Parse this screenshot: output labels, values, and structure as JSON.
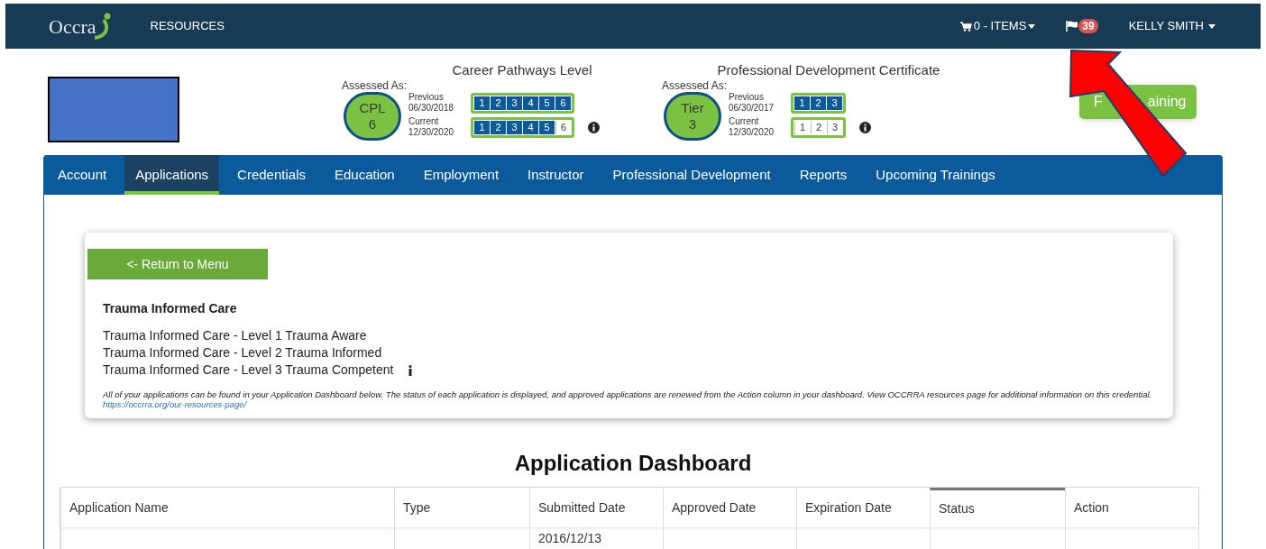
{
  "header": {
    "logo": "Occra",
    "nav": [
      {
        "label": "RESOURCES"
      }
    ],
    "cart": {
      "label": "0 - ITEMS"
    },
    "flag_count": "39",
    "user": "KELLY SMITH"
  },
  "career_pathways": {
    "title": "Career Pathways Level",
    "assessed_label": "Assessed As:",
    "badge": [
      "CPL",
      "6"
    ],
    "previous": {
      "label": "Previous",
      "date": "06/30/2018",
      "steps": [
        {
          "label": "1",
          "achieved": true
        },
        {
          "label": "2",
          "achieved": true
        },
        {
          "label": "3",
          "achieved": true
        },
        {
          "label": "4",
          "achieved": true
        },
        {
          "label": "5",
          "achieved": true
        },
        {
          "label": "6",
          "achieved": true
        }
      ]
    },
    "current": {
      "label": "Current",
      "date": "12/30/2020",
      "steps": [
        {
          "label": "1",
          "achieved": true
        },
        {
          "label": "2",
          "achieved": true
        },
        {
          "label": "3",
          "achieved": true
        },
        {
          "label": "4",
          "achieved": true
        },
        {
          "label": "5",
          "achieved": true
        },
        {
          "label": "6",
          "achieved": false
        }
      ]
    }
  },
  "pdc": {
    "title": "Professional Development Certificate",
    "assessed_label": "Assessed As:",
    "badge": [
      "Tier",
      "3"
    ],
    "previous": {
      "label": "Previous",
      "date": "06/30/2017",
      "steps": [
        {
          "label": "1",
          "achieved": true
        },
        {
          "label": "2",
          "achieved": true
        },
        {
          "label": "3",
          "achieved": true
        }
      ]
    },
    "current": {
      "label": "Current",
      "date": "12/30/2020",
      "steps": [
        {
          "label": "1",
          "achieved": false
        },
        {
          "label": "2",
          "achieved": false
        },
        {
          "label": "3",
          "achieved": false
        }
      ]
    }
  },
  "find_training_button": {
    "visible_parts": [
      "F",
      "aining"
    ]
  },
  "tabs": [
    {
      "label": "Account",
      "selected": false
    },
    {
      "label": "Applications",
      "selected": true
    },
    {
      "label": "Credentials",
      "selected": false
    },
    {
      "label": "Education",
      "selected": false
    },
    {
      "label": "Employment",
      "selected": false
    },
    {
      "label": "Instructor",
      "selected": false
    },
    {
      "label": "Professional Development",
      "selected": false
    },
    {
      "label": "Reports",
      "selected": false
    },
    {
      "label": "Upcoming Trainings",
      "selected": false
    }
  ],
  "card": {
    "return_button": "<- Return to Menu",
    "title": "Trauma Informed Care",
    "levels": [
      "Trauma Informed Care - Level 1 Trauma Aware",
      "Trauma Informed Care - Level 2 Trauma Informed",
      "Trauma Informed Care - Level 3 Trauma Competent"
    ],
    "note": "All of your applications can be found in your Application Dashboard below. The status of each application is displayed, and approved applications are renewed from the Action column in your dashboard. View OCCRRA resources page for additional information on this credential.",
    "link": "https://occrra.org/our-resources-page/"
  },
  "dashboard": {
    "title": "Application Dashboard",
    "columns": [
      {
        "label": "Application Name",
        "sorted": false
      },
      {
        "label": "Type",
        "sorted": false
      },
      {
        "label": "Submitted Date",
        "sorted": false
      },
      {
        "label": "Approved Date",
        "sorted": false
      },
      {
        "label": "Expiration Date",
        "sorted": false
      },
      {
        "label": "Status",
        "sorted": true
      },
      {
        "label": "Action",
        "sorted": false
      }
    ],
    "rows": [
      [
        "",
        "",
        "2016/12/13",
        "",
        "",
        "",
        ""
      ]
    ]
  }
}
